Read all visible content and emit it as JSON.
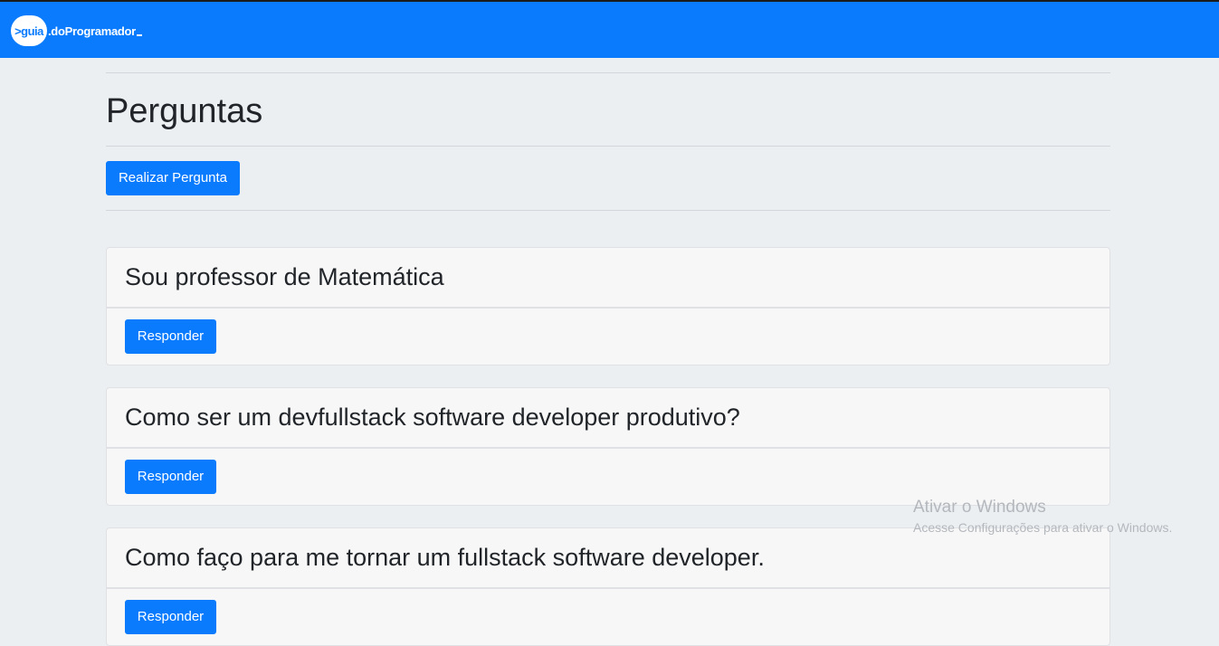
{
  "navbar": {
    "logo_circle_text": ">guia",
    "logo_rest_text": ".doProgramador"
  },
  "page": {
    "title": "Perguntas",
    "ask_button_label": "Realizar Pergunta"
  },
  "questions": [
    {
      "title": "Sou professor de Matemática",
      "reply_label": "Responder"
    },
    {
      "title": "Como ser um devfullstack software developer produtivo?",
      "reply_label": "Responder"
    },
    {
      "title": "Como faço para me tornar um fullstack software developer.",
      "reply_label": "Responder"
    }
  ],
  "watermark": {
    "title": "Ativar o Windows",
    "subtitle": "Acesse Configurações para ativar o Windows."
  },
  "colors": {
    "primary": "#0a7bfd",
    "background": "#eceff2",
    "card": "#f7f7f7"
  }
}
